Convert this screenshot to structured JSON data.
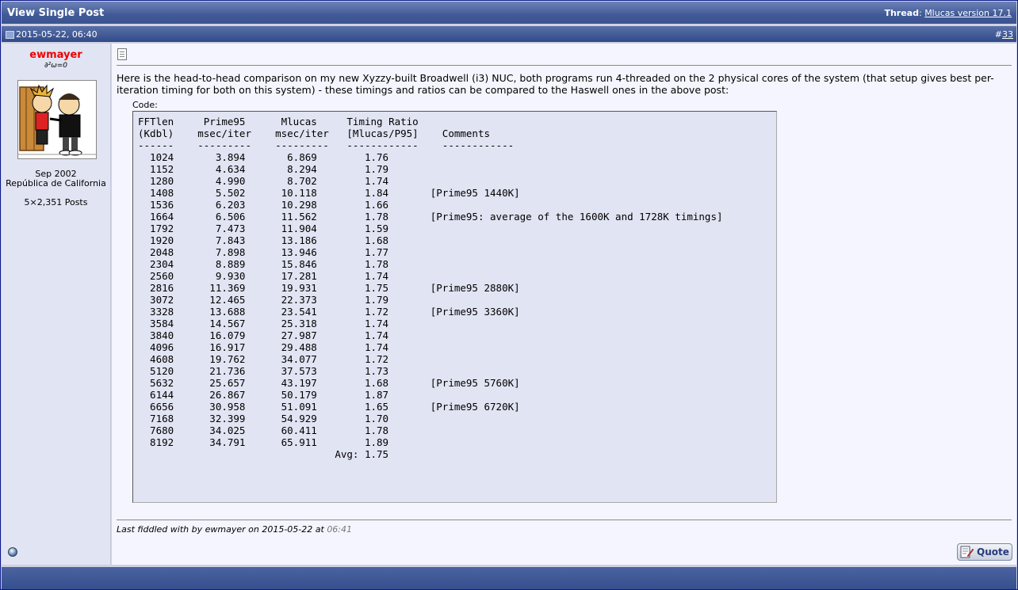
{
  "header": {
    "title": "View Single Post",
    "thread_label": "Thread",
    "thread_link": "Mlucas version 17.1"
  },
  "post": {
    "date": "2015-05-22, 06:40",
    "number_prefix": "#",
    "number": "33",
    "message": "Here is the head-to-head comparison on my new Xyzzy-built Broadwell (i3) NUC, both programs run 4-threaded on the 2 physical cores of the system (that setup gives best per-iteration timing for both on this system) - these timings and ratios can be compared to the Haswell ones in the above post:",
    "code_label": "Code:",
    "code": "FFTlen     Prime95      Mlucas     Timing Ratio\n(Kdbl)    msec/iter    msec/iter   [Mlucas/P95]    Comments\n------    ---------    ---------   ------------    ------------\n  1024       3.894       6.869        1.76\n  1152       4.634       8.294        1.79\n  1280       4.990       8.702        1.74\n  1408       5.502      10.118        1.84       [Prime95 1440K]\n  1536       6.203      10.298        1.66\n  1664       6.506      11.562        1.78       [Prime95: average of the 1600K and 1728K timings]\n  1792       7.473      11.904        1.59\n  1920       7.843      13.186        1.68\n  2048       7.898      13.946        1.77\n  2304       8.889      15.846        1.78\n  2560       9.930      17.281        1.74\n  2816      11.369      19.931        1.75       [Prime95 2880K]\n  3072      12.465      22.373        1.79\n  3328      13.688      23.541        1.72       [Prime95 3360K]\n  3584      14.567      25.318        1.74\n  3840      16.079      27.987        1.74\n  4096      16.917      29.488        1.74\n  4608      19.762      34.077        1.72\n  5120      21.736      37.573        1.73\n  5632      25.657      43.197        1.68       [Prime95 5760K]\n  6144      26.867      50.179        1.87\n  6656      30.958      51.091        1.65       [Prime95 6720K]\n  7168      32.399      54.929        1.70\n  7680      34.025      60.411        1.78\n  8192      34.791      65.911        1.89\n                                 Avg: 1.75",
    "edit_prefix": "Last fiddled with by ewmayer on 2015-05-22 at",
    "edit_time": "06:41",
    "quote_button": "Quote"
  },
  "user": {
    "name": "ewmayer",
    "title": "∂²ω=0",
    "join_date": "Sep 2002",
    "location": "República de California",
    "posts": "5×2,351 Posts"
  },
  "colors": {
    "header_bg": "#415a97",
    "username": "#e00000",
    "code_bg": "#e1e4f2"
  }
}
